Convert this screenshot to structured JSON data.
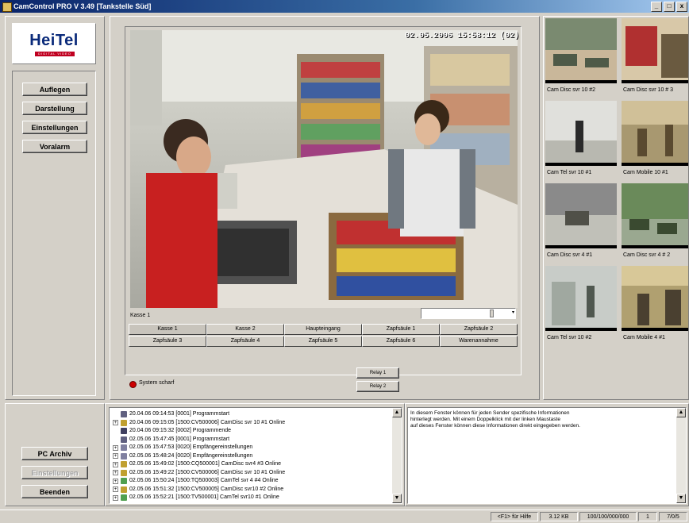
{
  "window": {
    "title": "CamControl PRO   V 3.49   [Tankstelle Süd]",
    "controls": [
      "_",
      "□",
      "x"
    ]
  },
  "logo": {
    "brand": "HeiTel",
    "tagline": "DIGITAL VIDEO"
  },
  "sidebar": {
    "buttons": [
      "Auflegen",
      "Darstellung",
      "Einstellungen",
      "Voralarm"
    ]
  },
  "video": {
    "osd_timestamp": "02.05.2006 15:58:12 (02)",
    "channel_label": "Kasse 1"
  },
  "camera_buttons": [
    [
      "Kasse 1",
      "Kasse 2",
      "Haupteingang",
      "Zapfsäule 1",
      "Zapfsäule 2"
    ],
    [
      "Zapfsäule 3",
      "Zapfsäule 4",
      "Zapfsäule 5",
      "Zapfsäule 6",
      "Warenannahme"
    ]
  ],
  "status": {
    "system_state": "System scharf",
    "indicator_color": "#cc0000"
  },
  "relays": [
    "Relay 1",
    "Relay 2"
  ],
  "thumbnails": [
    {
      "label": "Cam Disc svr 10 #2",
      "colors": [
        "#7a8a70",
        "#c9b79a",
        "#4e5a48"
      ]
    },
    {
      "label": "Cam Disc svr 10 # 3",
      "colors": [
        "#d8c8a8",
        "#b03030",
        "#6a5a40"
      ]
    },
    {
      "label": "Cam Tel svr 10 #1",
      "colors": [
        "#e0e0dc",
        "#b8b8b0",
        "#2a2a2a"
      ]
    },
    {
      "label": "Cam Mobile 10 #1",
      "colors": [
        "#a89870",
        "#d0c098",
        "#5a4a30"
      ]
    },
    {
      "label": "Cam Disc svr 4 #1",
      "colors": [
        "#8a8a8a",
        "#c0c0b8",
        "#505048"
      ]
    },
    {
      "label": "Cam Disc svr 4 # 2",
      "colors": [
        "#6a8a5a",
        "#9aa890",
        "#3a4a30"
      ]
    },
    {
      "label": "Cam Tel svr 10 #2",
      "colors": [
        "#c8ccc8",
        "#a0a8a0",
        "#505850"
      ]
    },
    {
      "label": "Cam Mobile 4 #1",
      "colors": [
        "#b0a070",
        "#d8c898",
        "#4a4030"
      ]
    }
  ],
  "bottom_buttons": {
    "archive": "PC Archiv",
    "settings": "Einstellungen",
    "exit": "Beenden"
  },
  "log": {
    "entries": [
      {
        "text": "20.04.06 09:14:53 [0001] Programmstart",
        "expand": "",
        "icon": "#606080"
      },
      {
        "text": "20.04.06 09:15:05 [1500:CV500006] CamDisc svr 10 #1 Online",
        "expand": "+",
        "icon": "#c0a030"
      },
      {
        "text": "20.04.06 09:15:32 [0002] Programmende",
        "expand": "",
        "icon": "#404060"
      },
      {
        "text": "02.05.06 15:47:45 [0001] Programmstart",
        "expand": "",
        "icon": "#606080"
      },
      {
        "text": "02.05.06 15:47:53 [0020] Empfängereinstellungen",
        "expand": "+",
        "icon": "#8080a0"
      },
      {
        "text": "02.05.06 15:48:24 [0020] Empfängereinstellungen",
        "expand": "+",
        "icon": "#8080a0"
      },
      {
        "text": "02.05.06 15:49:02 [1500:CQ500001] CamDisc svr4 #3 Online",
        "expand": "+",
        "icon": "#c0a030"
      },
      {
        "text": "02.05.06 15:49:22 [1500:CV500006] CamDisc svr 10 #1 Online",
        "expand": "+",
        "icon": "#c0a030"
      },
      {
        "text": "02.05.06 15:50:24 [1500:TQ500003] CamTel svr 4 #4 Online",
        "expand": "+",
        "icon": "#50a050"
      },
      {
        "text": "02.05.06 15:51:32 [1500:CV500005] CamDisc svr10 #2 Online",
        "expand": "+",
        "icon": "#c0a030"
      },
      {
        "text": "02.05.06 15:52:21 [1500:TV500001] CamTel svr10 #1 Online",
        "expand": "+",
        "icon": "#50a050"
      }
    ]
  },
  "info_text": [
    "In diesem Fenster können für jeden Sender spezifische Informationen",
    "hinterlegt werden. Mit einem Doppelklick mit der linken Maustaste",
    "auf dieses Fenster können diese Informationen direkt eingegeben werden."
  ],
  "statusbar": {
    "help": "<F1> für Hilfe",
    "size": "3.12 KB",
    "rate": "100/100/000/000",
    "count": "1",
    "ratio": "7/0/5"
  }
}
